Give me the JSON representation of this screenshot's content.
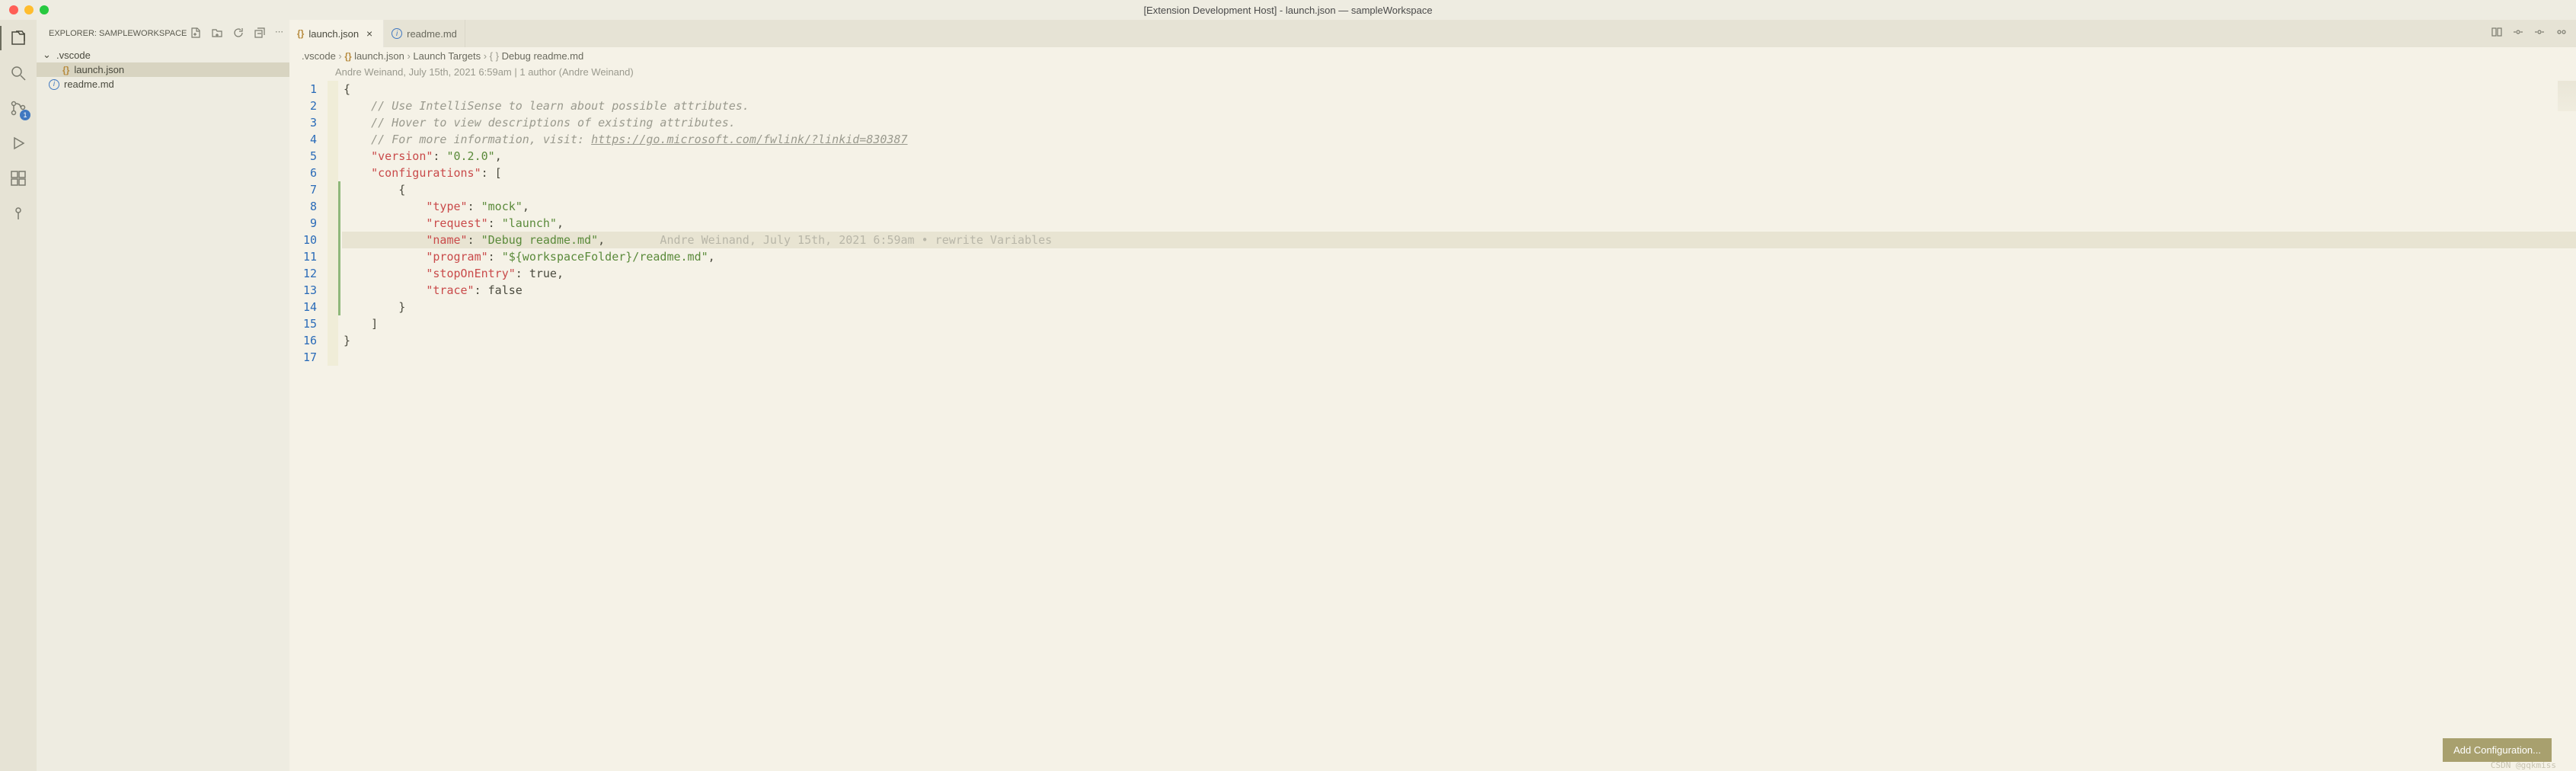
{
  "window": {
    "title": "[Extension Development Host] - launch.json — sampleWorkspace"
  },
  "sidebar": {
    "title": "EXPLORER: SAMPLEWORKSPACE",
    "folder": ".vscode",
    "items": [
      {
        "label": "launch.json",
        "icon": "json",
        "selected": true
      },
      {
        "label": "readme.md",
        "icon": "readme",
        "selected": false
      }
    ]
  },
  "scm_badge": "1",
  "tabs": [
    {
      "label": "launch.json",
      "icon": "json",
      "active": true,
      "closeable": true
    },
    {
      "label": "readme.md",
      "icon": "readme",
      "active": false,
      "closeable": false
    }
  ],
  "breadcrumbs": [
    {
      "label": ".vscode",
      "icon": null
    },
    {
      "label": "launch.json",
      "icon": "json"
    },
    {
      "label": "Launch Targets",
      "icon": null
    },
    {
      "label": "Debug readme.md",
      "icon": "braces"
    }
  ],
  "blame": {
    "header": "Andre Weinand, July 15th, 2021 6:59am | 1 author (Andre Weinand)",
    "inline": "Andre Weinand, July 15th, 2021 6:59am • rewrite Variables"
  },
  "editor": {
    "lines": [
      {
        "n": 1,
        "content": [
          {
            "t": "punct",
            "v": "{"
          }
        ],
        "indent": 0
      },
      {
        "n": 2,
        "content": [
          {
            "t": "comment",
            "v": "// Use IntelliSense to learn about possible attributes."
          }
        ],
        "indent": 1
      },
      {
        "n": 3,
        "content": [
          {
            "t": "comment",
            "v": "// Hover to view descriptions of existing attributes."
          }
        ],
        "indent": 1
      },
      {
        "n": 4,
        "content": [
          {
            "t": "comment",
            "v": "// For more information, visit: "
          },
          {
            "t": "link",
            "v": "https://go.microsoft.com/fwlink/?linkid=830387"
          }
        ],
        "indent": 1
      },
      {
        "n": 5,
        "content": [
          {
            "t": "key",
            "v": "\"version\""
          },
          {
            "t": "punct",
            "v": ": "
          },
          {
            "t": "string",
            "v": "\"0.2.0\""
          },
          {
            "t": "punct",
            "v": ","
          }
        ],
        "indent": 1
      },
      {
        "n": 6,
        "content": [
          {
            "t": "key",
            "v": "\"configurations\""
          },
          {
            "t": "punct",
            "v": ": ["
          }
        ],
        "indent": 1
      },
      {
        "n": 7,
        "content": [
          {
            "t": "punct",
            "v": "{"
          }
        ],
        "indent": 2,
        "diff": true
      },
      {
        "n": 8,
        "content": [
          {
            "t": "key",
            "v": "\"type\""
          },
          {
            "t": "punct",
            "v": ": "
          },
          {
            "t": "string",
            "v": "\"mock\""
          },
          {
            "t": "punct",
            "v": ","
          }
        ],
        "indent": 3,
        "diff": true
      },
      {
        "n": 9,
        "content": [
          {
            "t": "key",
            "v": "\"request\""
          },
          {
            "t": "punct",
            "v": ": "
          },
          {
            "t": "string",
            "v": "\"launch\""
          },
          {
            "t": "punct",
            "v": ","
          }
        ],
        "indent": 3,
        "diff": true
      },
      {
        "n": 10,
        "content": [
          {
            "t": "key",
            "v": "\"name\""
          },
          {
            "t": "punct",
            "v": ": "
          },
          {
            "t": "string",
            "v": "\"Debug readme.md\""
          },
          {
            "t": "punct",
            "v": ","
          }
        ],
        "indent": 3,
        "diff": true,
        "highlighted": true,
        "blame": true
      },
      {
        "n": 11,
        "content": [
          {
            "t": "key",
            "v": "\"program\""
          },
          {
            "t": "punct",
            "v": ": "
          },
          {
            "t": "string",
            "v": "\"${workspaceFolder}/readme.md\""
          },
          {
            "t": "punct",
            "v": ","
          }
        ],
        "indent": 3,
        "diff": true
      },
      {
        "n": 12,
        "content": [
          {
            "t": "key",
            "v": "\"stopOnEntry\""
          },
          {
            "t": "punct",
            "v": ": "
          },
          {
            "t": "bool",
            "v": "true"
          },
          {
            "t": "punct",
            "v": ","
          }
        ],
        "indent": 3,
        "diff": true
      },
      {
        "n": 13,
        "content": [
          {
            "t": "key",
            "v": "\"trace\""
          },
          {
            "t": "punct",
            "v": ": "
          },
          {
            "t": "bool",
            "v": "false"
          }
        ],
        "indent": 3,
        "diff": true
      },
      {
        "n": 14,
        "content": [
          {
            "t": "punct",
            "v": "}"
          }
        ],
        "indent": 2,
        "diff": true
      },
      {
        "n": 15,
        "content": [
          {
            "t": "punct",
            "v": "]"
          }
        ],
        "indent": 1
      },
      {
        "n": 16,
        "content": [
          {
            "t": "punct",
            "v": "}"
          }
        ],
        "indent": 0
      },
      {
        "n": 17,
        "content": [],
        "indent": 0
      }
    ]
  },
  "add_config_label": "Add Configuration...",
  "watermark": "CSDN @gqkmiss"
}
